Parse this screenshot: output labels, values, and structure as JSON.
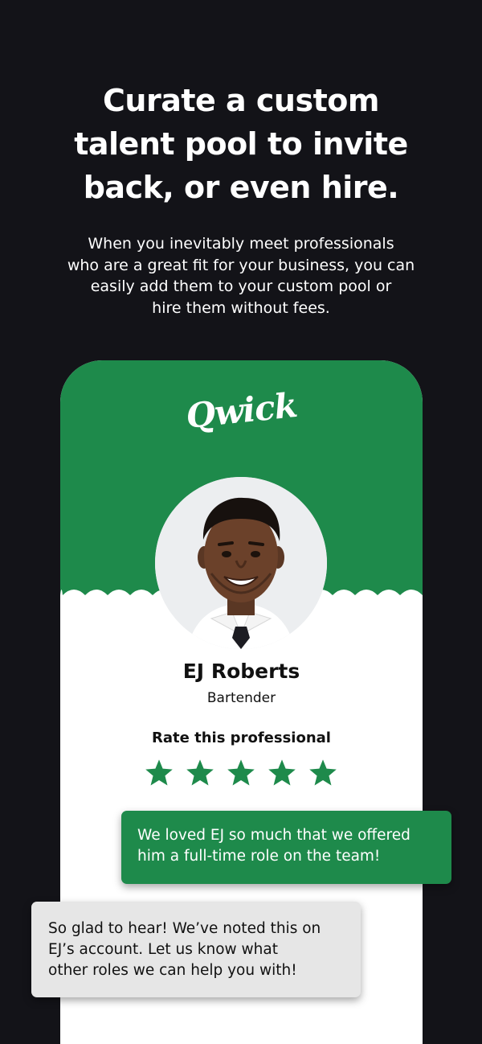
{
  "headline": {
    "line1": "Curate a custom",
    "line2": "talent pool to invite",
    "line3": "back, or even hire."
  },
  "subtext": {
    "line1": "When you inevitably meet professionals",
    "line2": "who are a great fit for your business, you can",
    "line3": "easily add them to your custom pool or",
    "line4": "hire them without fees."
  },
  "app": {
    "logo": "Qwick",
    "brand_color": "#1e8a4b",
    "profile": {
      "name": "EJ Roberts",
      "role": "Bartender",
      "avatar_icon": "person-photo"
    },
    "rating": {
      "title": "Rate this professional",
      "max_stars": 5,
      "star_icon": "star-icon"
    }
  },
  "messages": {
    "business": {
      "line1": "We loved EJ so much that we offered",
      "line2": "him a full-time role on the team!"
    },
    "qwick": {
      "line1": "So glad to hear! We’ve noted this on",
      "line2": "EJ’s account. Let us know what",
      "line3": "other roles we can help you with!"
    }
  }
}
